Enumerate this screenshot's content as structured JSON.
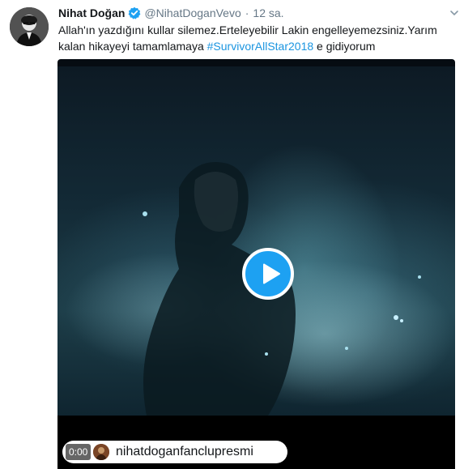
{
  "tweet": {
    "author_name": "Nihat Doğan",
    "handle": "@NihatDoganVevo",
    "separator": "·",
    "time": "12 sa.",
    "text_part1": "Allah'ın yazdığını kullar silemez.Erteleyebilir Lakin engelleyemezsiniz.Yarım kalan hikayeyi tamamlamaya ",
    "hashtag": "#SurvivorAllStar2018",
    "text_part2": " e gidiyorum"
  },
  "video": {
    "duration": "0:00",
    "source_name": "nihatdoganfanclupresmi"
  },
  "colors": {
    "link": "#1b95e0",
    "play_button": "#1da1f2",
    "verified": "#1da1f2"
  },
  "icons": [
    "verified-badge-icon",
    "caret-down-icon",
    "play-icon"
  ]
}
